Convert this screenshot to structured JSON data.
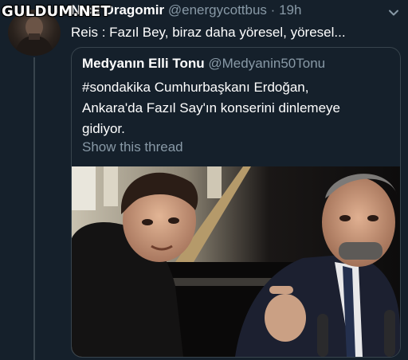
{
  "watermark": "GULDUM.NET",
  "tweet": {
    "display_name": "Nicu Dragomir",
    "handle": "@energycottbus",
    "separator": "·",
    "time": "19h",
    "text": "Reis : Fazıl Bey, biraz daha yöresel, yöresel..."
  },
  "quoted": {
    "display_name": "Medyanın Elli Tonu",
    "handle": "@Medyanin50Tonu",
    "lines": [
      "#sondakika Cumhurbaşkanı Erdoğan,",
      "Ankara'da Fazıl Say'ın konserini dinlemeye",
      "gidiyor."
    ],
    "show_thread": "Show this thread"
  },
  "icons": {
    "menu": "chevron-down-icon"
  },
  "colors": {
    "background": "#15202b",
    "border": "#38444d",
    "secondary_text": "#8899a6"
  }
}
